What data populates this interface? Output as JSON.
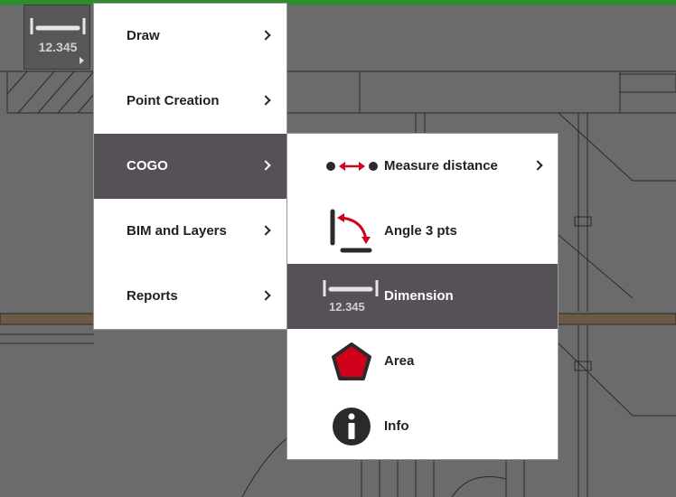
{
  "tool_button": {
    "value_label": "12.345"
  },
  "main_menu": {
    "items": [
      {
        "label": "Draw",
        "has_submenu": true,
        "active": false
      },
      {
        "label": "Point Creation",
        "has_submenu": true,
        "active": false
      },
      {
        "label": "COGO",
        "has_submenu": true,
        "active": true
      },
      {
        "label": "BIM and Layers",
        "has_submenu": true,
        "active": false
      },
      {
        "label": "Reports",
        "has_submenu": true,
        "active": false
      }
    ]
  },
  "cogo_submenu": {
    "items": [
      {
        "label": "Measure distance",
        "icon": "measure-distance-icon",
        "has_submenu": true,
        "active": false
      },
      {
        "label": "Angle 3 pts",
        "icon": "angle-icon",
        "has_submenu": false,
        "active": false
      },
      {
        "label": "Dimension",
        "icon": "dimension-icon",
        "icon_value": "12.345",
        "has_submenu": false,
        "active": true
      },
      {
        "label": "Area",
        "icon": "area-pentagon-icon",
        "has_submenu": false,
        "active": false
      },
      {
        "label": "Info",
        "icon": "info-icon",
        "has_submenu": false,
        "active": false
      }
    ]
  },
  "colors": {
    "accent_red": "#d0021b",
    "menu_active": "#555156",
    "canvas_gray": "#6b6b6b",
    "top_bar_green": "#2e8b2e"
  }
}
